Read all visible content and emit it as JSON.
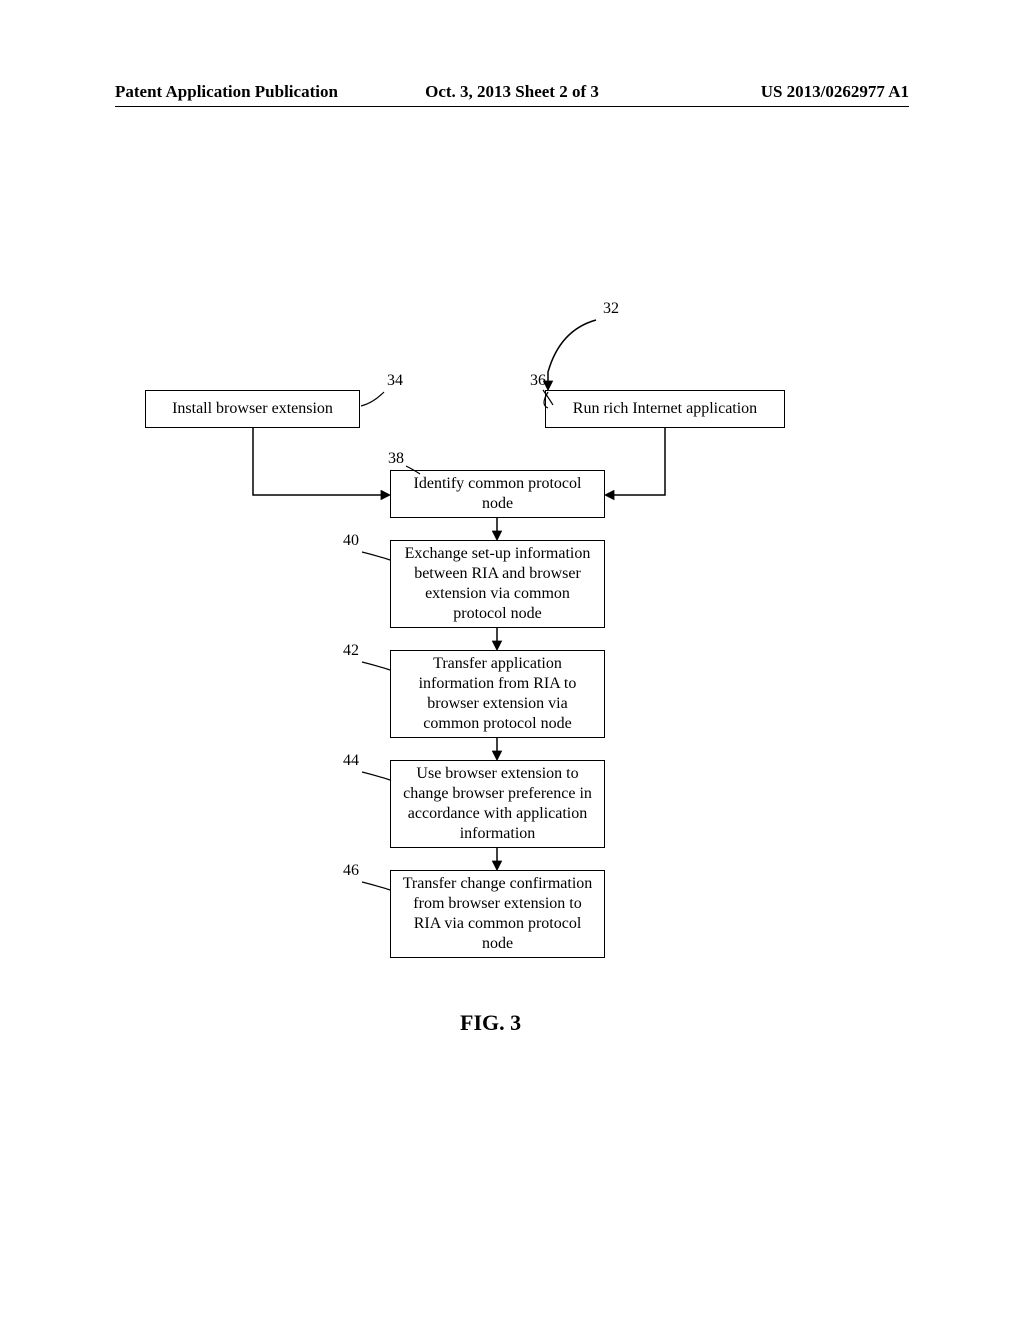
{
  "header": {
    "left": "Patent Application Publication",
    "center": "Oct. 3, 2013   Sheet 2 of 3",
    "right": "US 2013/0262977 A1"
  },
  "refs": {
    "r32": "32",
    "r34": "34",
    "r36": "36",
    "r38": "38",
    "r40": "40",
    "r42": "42",
    "r44": "44",
    "r46": "46"
  },
  "boxes": {
    "install": "Install browser extension",
    "run": "Run rich Internet application",
    "identify": "Identify common protocol node",
    "exchange": "Exchange set-up information between RIA and browser extension via common protocol node",
    "transferApp": "Transfer application information from RIA to browser extension via common protocol node",
    "useExt": "Use browser extension to change browser preference in accordance with application information",
    "transferConfirm": "Transfer change confirmation from browser extension to RIA via common protocol node"
  },
  "figure": "FIG. 3"
}
